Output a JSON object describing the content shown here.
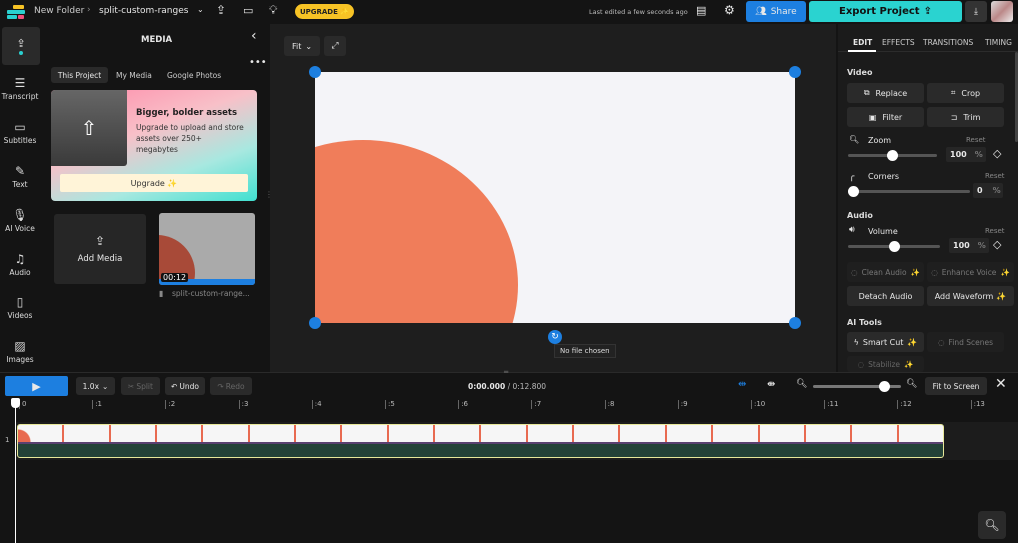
{
  "topbar": {
    "breadcrumb_folder": "New Folder",
    "project_name": "split-custom-ranges",
    "upgrade": "UPGRADE",
    "last_edited": "Last edited a few seconds ago",
    "share": "Share",
    "export": "Export Project"
  },
  "rail": [
    {
      "label": "",
      "icon": "upload-icon"
    },
    {
      "label": "Transcript",
      "icon": "transcript-icon"
    },
    {
      "label": "Subtitles",
      "icon": "subtitles-icon"
    },
    {
      "label": "Text",
      "icon": "text-icon"
    },
    {
      "label": "AI Voice",
      "icon": "ai-voice-icon"
    },
    {
      "label": "Audio",
      "icon": "audio-icon"
    },
    {
      "label": "Videos",
      "icon": "videos-icon"
    },
    {
      "label": "Images",
      "icon": "images-icon"
    }
  ],
  "media": {
    "title": "MEDIA",
    "tabs": [
      "This Project",
      "My Media",
      "Google Photos"
    ],
    "promo_title": "Bigger, bolder assets",
    "promo_text": "Upgrade to upload and store assets over 250+ megabytes",
    "promo_button": "Upgrade",
    "add_media": "Add Media",
    "clip_duration": "00:12",
    "clip_name": "split-custom-range..."
  },
  "canvas": {
    "fit": "Fit",
    "file_tooltip": "No file chosen",
    "accent": "#1d7fe0",
    "circle_color": "#f07d5a"
  },
  "edit": {
    "tabs": [
      "EDIT",
      "EFFECTS",
      "TRANSITIONS",
      "TIMING"
    ],
    "video_label": "Video",
    "replace": "Replace",
    "crop": "Crop",
    "filter": "Filter",
    "trim": "Trim",
    "zoom_label": "Zoom",
    "zoom_value": "100",
    "corners_label": "Corners",
    "corners_value": "0",
    "reset": "Reset",
    "pct": "%",
    "audio_label": "Audio",
    "volume_label": "Volume",
    "volume_value": "100",
    "clean_audio": "Clean Audio",
    "enhance_voice": "Enhance Voice",
    "detach_audio": "Detach Audio",
    "add_waveform": "Add Waveform",
    "ai_tools": "AI Tools",
    "smart_cut": "Smart Cut",
    "find_scenes": "Find Scenes",
    "stabilize": "Stabilize",
    "zoom_level": 0.5,
    "corners_level": 0,
    "volume_level": 0.5
  },
  "timeline": {
    "speed": "1.0x",
    "split": "Split",
    "undo": "Undo",
    "redo": "Redo",
    "current_time": "0:00.000",
    "total_time": "/ 0:12.800",
    "fit_to_screen": "Fit to Screen",
    "ticks": [
      "0",
      ":1",
      ":2",
      ":3",
      ":4",
      ":5",
      ":6",
      ":7",
      ":8",
      ":9",
      ":10",
      ":11",
      ":12",
      ":13"
    ],
    "track_number": "1",
    "zoom_level": 0.86
  }
}
